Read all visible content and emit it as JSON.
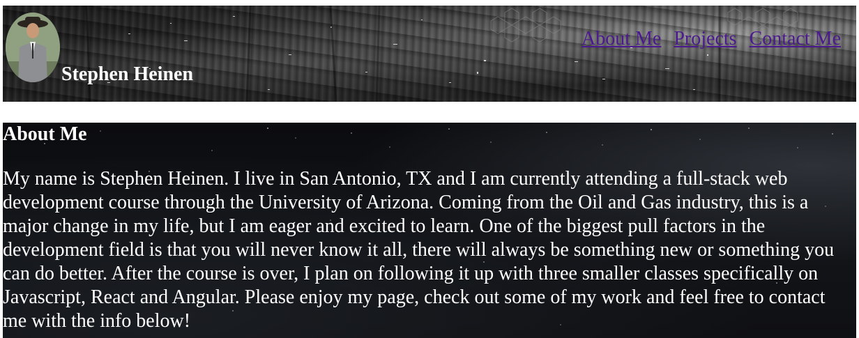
{
  "header": {
    "site_name": "Stephen Heinen",
    "avatar_alt": "Stephen Heinen profile photo",
    "nav": [
      {
        "label": "About Me"
      },
      {
        "label": "Projects"
      },
      {
        "label": "Contact Me"
      }
    ]
  },
  "about": {
    "heading": "About Me",
    "body": "My name is Stephen Heinen. I live in San Antonio, TX and I am currently attending a full-stack web development course through the University of Arizona. Coming from the Oil and Gas industry, this is a major change in my life, but I am eager and excited to learn. One of the biggest pull factors in the development field is that you will never know it all, there will always be something new or something you can do better. After the course is over, I plan on following it up with three smaller classes specifically on Javascript, React and Angular. Please enjoy my page, check out some of my work and feel free to contact me with the info below!"
  },
  "colors": {
    "link": "#4b1a8f",
    "text_light": "#ffffff",
    "page_bg": "#ffffff"
  }
}
